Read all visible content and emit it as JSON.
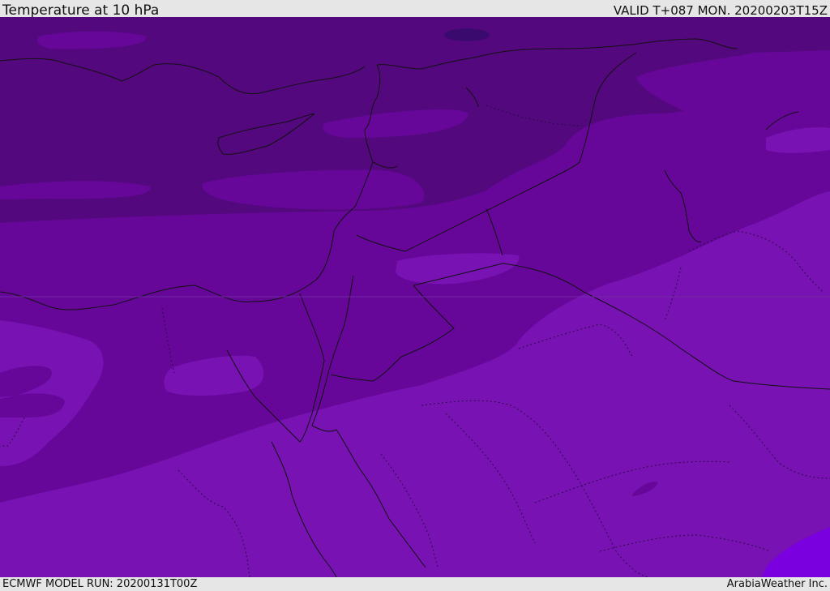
{
  "header": {
    "title": "Temperature at 10 hPa",
    "valid": "VALID T+087 MON. 20200203T15Z"
  },
  "footer": {
    "model_run": "ECMWF MODEL RUN: 20200131T00Z",
    "credit": "ArabiaWeather Inc."
  },
  "map": {
    "colors": {
      "darkest": "#3a0a6e",
      "dark": "#54087e",
      "mid": "#66079a",
      "light": "#7812b2",
      "lightest": "#7a00e0",
      "coast": "#111111"
    }
  }
}
